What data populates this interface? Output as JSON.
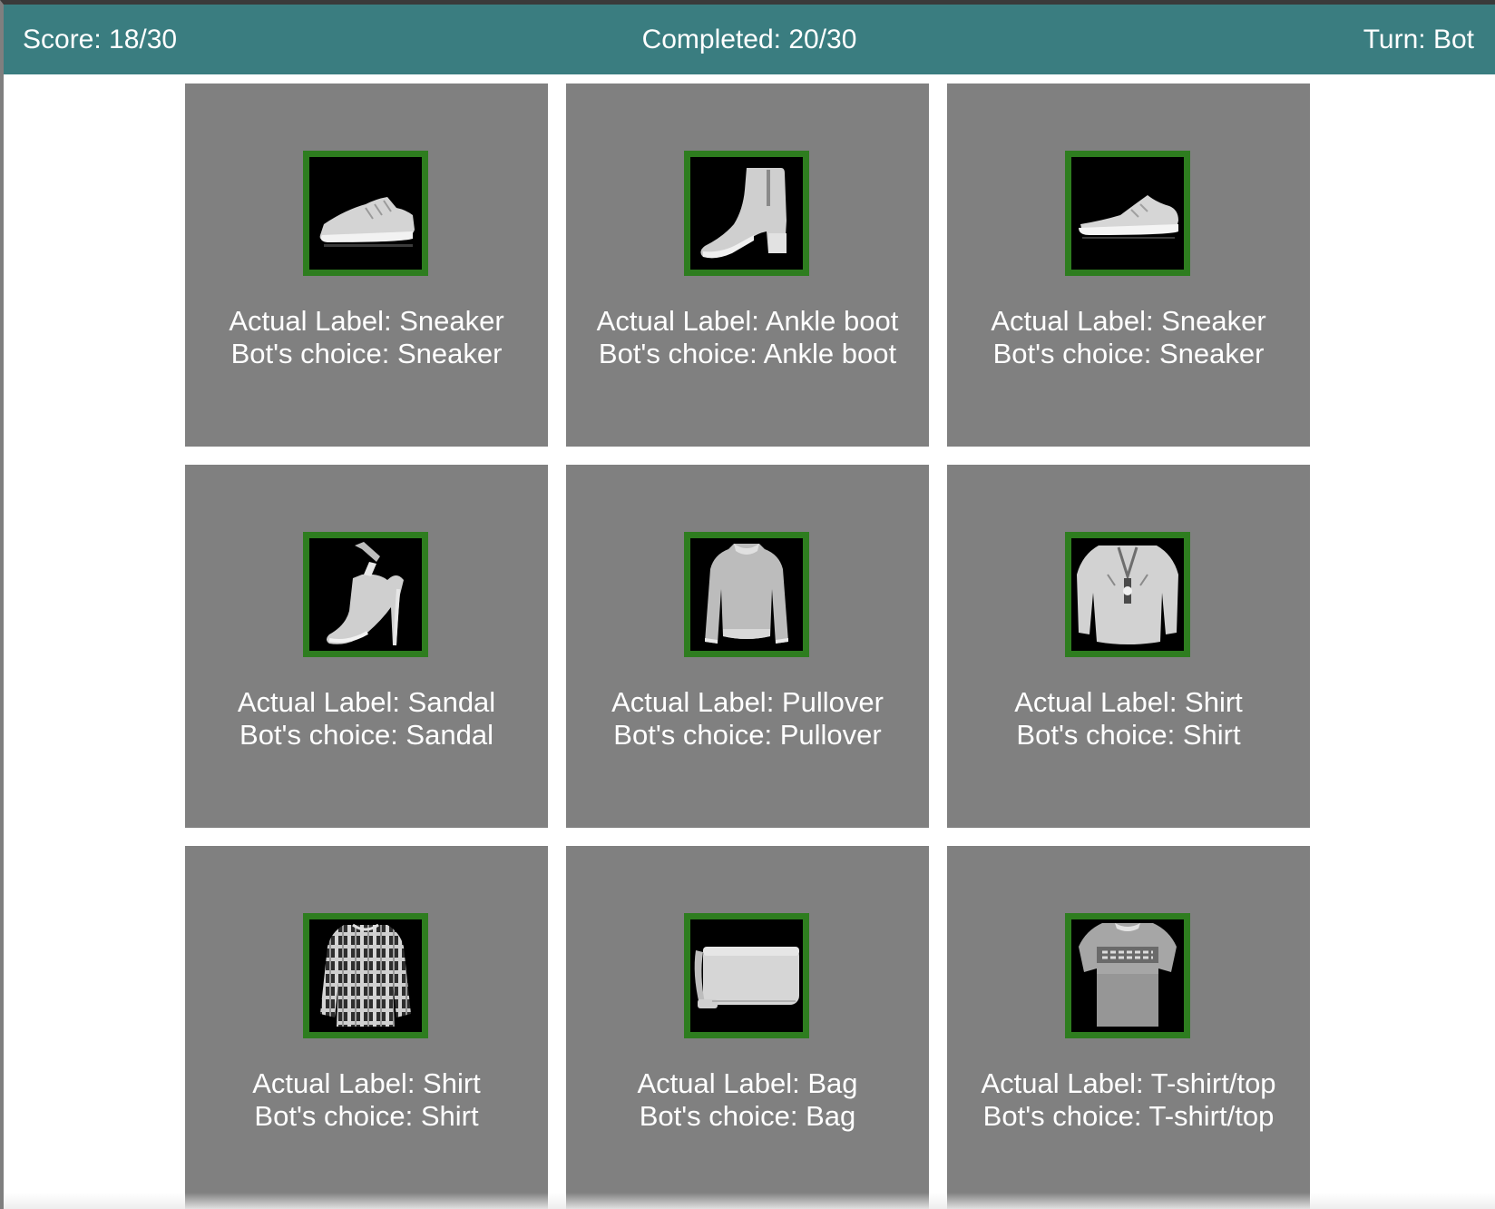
{
  "header": {
    "score": "Score: 18/30",
    "completed": "Completed: 20/30",
    "turn": "Turn: Bot"
  },
  "colors": {
    "header_bg": "#3a7d80",
    "card_bg": "#808080",
    "correct_border": "#2e7d1f",
    "thumb_bg": "#000000"
  },
  "cards": [
    {
      "icon": "sneaker-icon",
      "actual": "Actual Label: Sneaker",
      "bot": "Bot's choice: Sneaker"
    },
    {
      "icon": "ankle-boot-icon",
      "actual": "Actual Label: Ankle boot",
      "bot": "Bot's choice: Ankle boot"
    },
    {
      "icon": "sneaker-icon",
      "actual": "Actual Label: Sneaker",
      "bot": "Bot's choice: Sneaker"
    },
    {
      "icon": "sandal-icon",
      "actual": "Actual Label: Sandal",
      "bot": "Bot's choice: Sandal"
    },
    {
      "icon": "pullover-icon",
      "actual": "Actual Label: Pullover",
      "bot": "Bot's choice: Pullover"
    },
    {
      "icon": "shirt-icon",
      "actual": "Actual Label: Shirt",
      "bot": "Bot's choice: Shirt"
    },
    {
      "icon": "plaid-shirt-icon",
      "actual": "Actual Label: Shirt",
      "bot": "Bot's choice: Shirt"
    },
    {
      "icon": "bag-icon",
      "actual": "Actual Label: Bag",
      "bot": "Bot's choice: Bag"
    },
    {
      "icon": "tshirt-icon",
      "actual": "Actual Label: T-shirt/top",
      "bot": "Bot's choice: T-shirt/top"
    }
  ]
}
